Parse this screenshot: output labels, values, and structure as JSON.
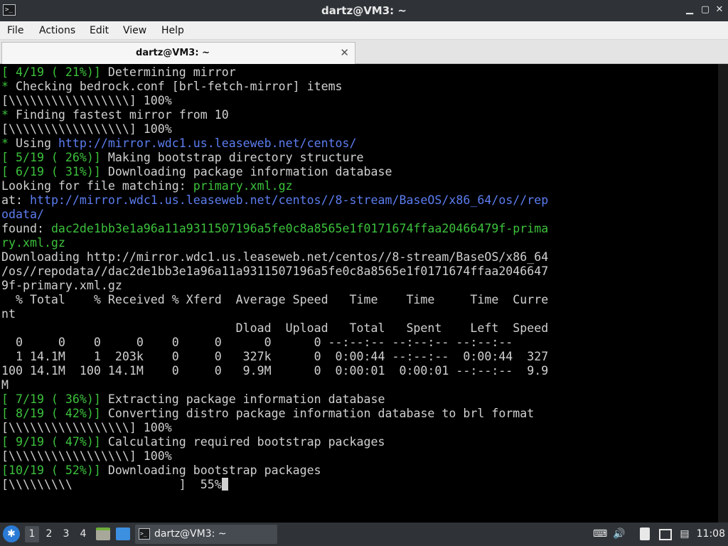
{
  "window": {
    "title": "dartz@VM3: ~",
    "app_icon_glyph": ">_",
    "minimize_glyph": "▁",
    "maximize_glyph": "▢",
    "close_glyph": "✕"
  },
  "menu": {
    "file": "File",
    "actions": "Actions",
    "edit": "Edit",
    "view": "View",
    "help": "Help"
  },
  "tab": {
    "title": "dartz@VM3: ~",
    "close_glyph": "✕"
  },
  "terminal": {
    "lines": [
      {
        "segments": [
          {
            "t": "[ 4/19 ( 21%)]",
            "c": "green"
          },
          {
            "t": " Determining mirror"
          }
        ]
      },
      {
        "segments": [
          {
            "t": "*",
            "c": "green"
          },
          {
            "t": " Checking bedrock.conf [brl-fetch-mirror] items"
          }
        ]
      },
      {
        "segments": [
          {
            "t": "[\\\\\\\\\\\\\\\\\\\\\\\\\\\\\\\\\\] 100%"
          }
        ]
      },
      {
        "segments": [
          {
            "t": "*",
            "c": "green"
          },
          {
            "t": " Finding fastest mirror from 10"
          }
        ]
      },
      {
        "segments": [
          {
            "t": "[\\\\\\\\\\\\\\\\\\\\\\\\\\\\\\\\\\] 100%"
          }
        ]
      },
      {
        "segments": [
          {
            "t": "*",
            "c": "green"
          },
          {
            "t": " Using "
          },
          {
            "t": "http://mirror.wdc1.us.leaseweb.net/centos/",
            "c": "blue"
          }
        ]
      },
      {
        "segments": [
          {
            "t": "[ 5/19 ( 26%)]",
            "c": "green"
          },
          {
            "t": " Making bootstrap directory structure"
          }
        ]
      },
      {
        "segments": [
          {
            "t": "[ 6/19 ( 31%)]",
            "c": "green"
          },
          {
            "t": " Downloading package information database"
          }
        ]
      },
      {
        "segments": [
          {
            "t": "Looking for file matching: "
          },
          {
            "t": "primary.xml.gz",
            "c": "green"
          }
        ]
      },
      {
        "segments": [
          {
            "t": "at: "
          },
          {
            "t": "http://mirror.wdc1.us.leaseweb.net/centos//8-stream/BaseOS/x86_64/os//rep",
            "c": "blue"
          }
        ]
      },
      {
        "segments": [
          {
            "t": "odata/",
            "c": "blue"
          }
        ]
      },
      {
        "segments": [
          {
            "t": "found: "
          },
          {
            "t": "dac2de1bb3e1a96a11a9311507196a5fe0c8a8565e1f0171674ffaa20466479f-prima",
            "c": "green"
          }
        ]
      },
      {
        "segments": [
          {
            "t": "ry.xml.gz",
            "c": "green"
          }
        ]
      },
      {
        "segments": [
          {
            "t": "Downloading http://mirror.wdc1.us.leaseweb.net/centos//8-stream/BaseOS/x86_64"
          }
        ]
      },
      {
        "segments": [
          {
            "t": "/os//repodata//dac2de1bb3e1a96a11a9311507196a5fe0c8a8565e1f0171674ffaa2046647"
          }
        ]
      },
      {
        "segments": [
          {
            "t": "9f-primary.xml.gz"
          }
        ]
      },
      {
        "segments": [
          {
            "t": "  % Total    % Received % Xferd  Average Speed   Time    Time     Time  Curre"
          }
        ]
      },
      {
        "segments": [
          {
            "t": "nt"
          }
        ]
      },
      {
        "segments": [
          {
            "t": "                                 Dload  Upload   Total   Spent    Left  Speed"
          }
        ]
      },
      {
        "segments": [
          {
            "t": "  0     0    0     0    0     0      0      0 --:--:-- --:--:-- --:--:--"
          }
        ]
      },
      {
        "segments": [
          {
            "t": "  1 14.1M    1  203k    0     0   327k      0  0:00:44 --:--:--  0:00:44  327"
          }
        ]
      },
      {
        "segments": [
          {
            "t": "100 14.1M  100 14.1M    0     0   9.9M      0  0:00:01  0:00:01 --:--:--  9.9"
          }
        ]
      },
      {
        "segments": [
          {
            "t": "M"
          }
        ]
      },
      {
        "segments": [
          {
            "t": "[ 7/19 ( 36%)]",
            "c": "green"
          },
          {
            "t": " Extracting package information database"
          }
        ]
      },
      {
        "segments": [
          {
            "t": "[ 8/19 ( 42%)]",
            "c": "green"
          },
          {
            "t": " Converting distro package information database to brl format"
          }
        ]
      },
      {
        "segments": [
          {
            "t": "[\\\\\\\\\\\\\\\\\\\\\\\\\\\\\\\\\\] 100%"
          }
        ]
      },
      {
        "segments": [
          {
            "t": "[ 9/19 ( 47%)]",
            "c": "green"
          },
          {
            "t": " Calculating required bootstrap packages"
          }
        ]
      },
      {
        "segments": [
          {
            "t": "[\\\\\\\\\\\\\\\\\\\\\\\\\\\\\\\\\\] 100%"
          }
        ]
      },
      {
        "segments": [
          {
            "t": "[10/19 ( 52%)]",
            "c": "green"
          },
          {
            "t": " Downloading bootstrap packages"
          }
        ]
      },
      {
        "segments": [
          {
            "t": "[\\\\\\\\\\\\\\\\\\               ]  55%"
          }
        ],
        "cursor": true
      }
    ]
  },
  "taskbar": {
    "desktops": [
      "1",
      "2",
      "3",
      "4"
    ],
    "active_desktop": "1",
    "task_label": "dartz@VM3: ~",
    "task_icon_glyph": ">_",
    "clock": "11:08"
  },
  "colors": {
    "green": "#3cc23c",
    "blue": "#5c7df0",
    "default_text": "#d0d0d0",
    "background": "#000000"
  },
  "icons": {
    "start": "lxqt-start-icon",
    "file_manager": "file-manager-icon",
    "show_desktop": "show-desktop-icon",
    "tray": [
      "keyboard-icon",
      "volume-icon",
      "clipboard-icon",
      "display-icon",
      "network-icon"
    ]
  }
}
